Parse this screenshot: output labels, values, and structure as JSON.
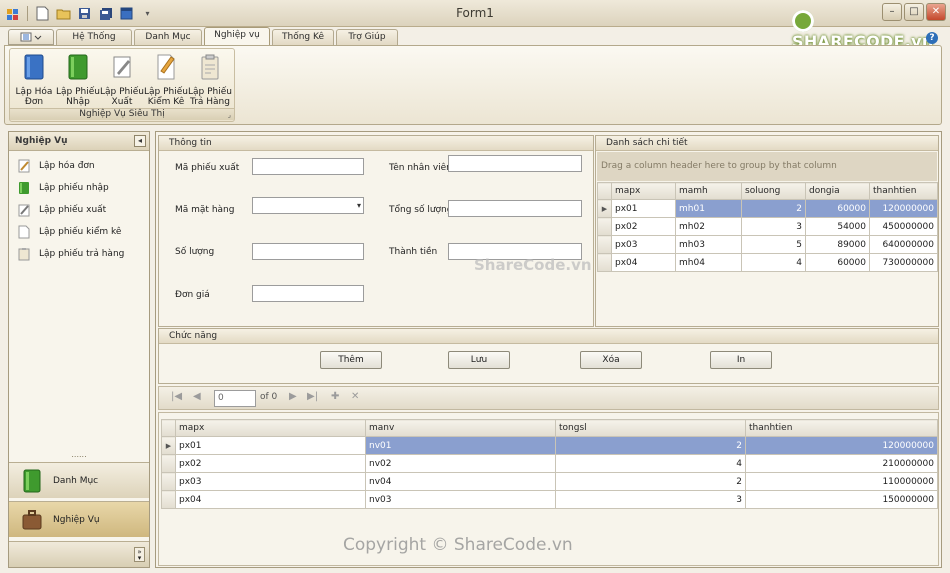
{
  "window": {
    "title": "Form1"
  },
  "tabs": [
    "Hệ Thống",
    "Danh Mục",
    "Nghiệp vụ",
    "Thống Kê",
    "Trợ Giúp"
  ],
  "ribbon": {
    "group_label": "Nghiệp Vụ Siêu Thị",
    "buttons": [
      {
        "line1": "Lập Hóa",
        "line2": "Đơn"
      },
      {
        "line1": "Lập Phiếu",
        "line2": "Nhập"
      },
      {
        "line1": "Lập Phiếu",
        "line2": "Xuất"
      },
      {
        "line1": "Lập Phiếu",
        "line2": "Kiểm Kê"
      },
      {
        "line1": "Lập Phiếu",
        "line2": "Trả Hàng"
      }
    ]
  },
  "nav": {
    "header": "Nghiệp Vụ",
    "items": [
      "Lập hóa đơn",
      "Lập phiếu nhập",
      "Lập phiếu xuất",
      "Lập phiếu kiểm kê",
      "Lập phiếu trả hàng"
    ],
    "panes": [
      "Danh Mục",
      "Nghiệp Vụ"
    ]
  },
  "info": {
    "title": "Thông tin",
    "labels": {
      "ma_phieu_xuat": "Mã phiếu xuất",
      "ma_mat_hang": "Mã mặt hàng",
      "so_luong": "Số lượng",
      "don_gia": "Đơn giá",
      "ten_nhan_vien": "Tên nhân viên",
      "tong_so_luong": "Tổng số lượng",
      "thanh_tien": "Thành tiền"
    }
  },
  "detail": {
    "title": "Danh sách chi tiết",
    "groupby_hint": "Drag a column header here to group by that column",
    "columns": [
      "mapx",
      "mamh",
      "soluong",
      "dongia",
      "thanhtien"
    ],
    "rows": [
      [
        "px01",
        "mh01",
        "2",
        "60000",
        "120000000"
      ],
      [
        "px02",
        "mh02",
        "3",
        "54000",
        "450000000"
      ],
      [
        "px03",
        "mh03",
        "5",
        "89000",
        "640000000"
      ],
      [
        "px04",
        "mh04",
        "4",
        "60000",
        "730000000"
      ]
    ]
  },
  "functions": {
    "title": "Chức năng",
    "buttons": [
      "Thêm",
      "Lưu",
      "Xóa",
      "In"
    ]
  },
  "navigator": {
    "position": "0",
    "of_label": "of 0"
  },
  "master": {
    "columns": [
      "mapx",
      "manv",
      "tongsl",
      "thanhtien"
    ],
    "rows": [
      [
        "px01",
        "nv01",
        "2",
        "120000000"
      ],
      [
        "px02",
        "nv02",
        "4",
        "210000000"
      ],
      [
        "px03",
        "nv04",
        "2",
        "110000000"
      ],
      [
        "px04",
        "nv03",
        "3",
        "150000000"
      ]
    ]
  },
  "watermarks": {
    "logo": "SHARECODE.vn",
    "center": "ShareCode.vn",
    "footer": "Copyright © ShareCode.vn"
  },
  "colors": {
    "selection": "#8a9fcf",
    "ribbon_bg": "#ece5d3",
    "nav_active_pane": "#cfb77e"
  },
  "icons": [
    "app-icon",
    "new-file-icon",
    "open-folder-icon",
    "save-icon",
    "save-all-icon",
    "window-icon",
    "qat-dropdown-icon",
    "help-icon"
  ]
}
